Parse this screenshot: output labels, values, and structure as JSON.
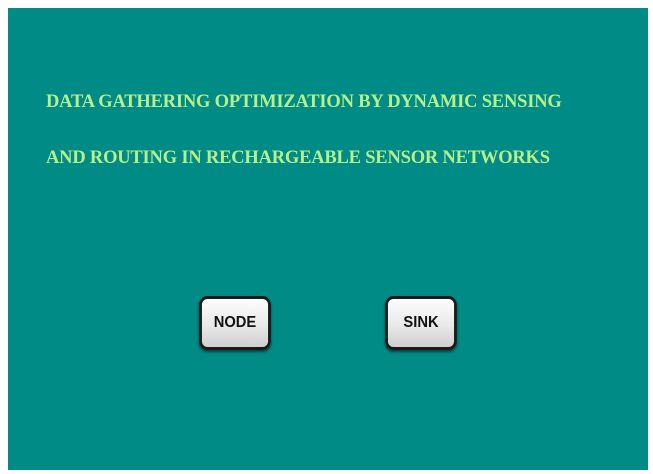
{
  "title": {
    "line1": "DATA GATHERING OPTIMIZATION BY DYNAMIC SENSING",
    "line2": "AND ROUTING IN RECHARGEABLE SENSOR NETWORKS"
  },
  "buttons": {
    "node_label": "NODE",
    "sink_label": "SINK"
  },
  "colors": {
    "background": "#008b86",
    "title_text": "#b6f08a",
    "button_border": "#1a1a1a"
  }
}
